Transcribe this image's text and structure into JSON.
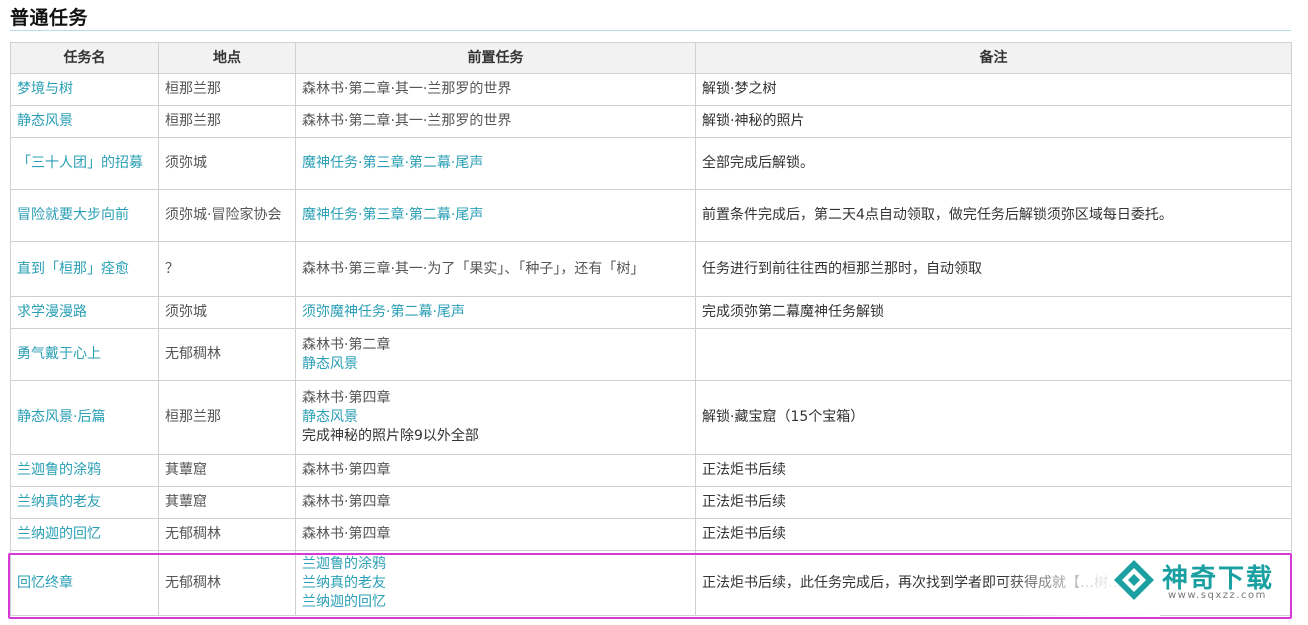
{
  "section_title": "普通任务",
  "table": {
    "headers": [
      "任务名",
      "地点",
      "前置任务",
      "备注"
    ],
    "rows": [
      {
        "name": "梦境与树",
        "location": "桓那兰那",
        "prereq": [
          "森林书·第二章·其一·兰那罗的世界"
        ],
        "prereq_link": false,
        "note": "解锁·梦之树"
      },
      {
        "name": "静态风景",
        "location": "桓那兰那",
        "prereq": [
          "森林书·第二章·其一·兰那罗的世界"
        ],
        "prereq_link": false,
        "note": "解锁·神秘的照片"
      },
      {
        "name": "「三十人团」的招募",
        "location": "须弥城",
        "prereq": [
          "魔神任务·第三章·第二幕·尾声"
        ],
        "prereq_link": true,
        "note": "全部完成后解锁。"
      },
      {
        "name": "冒险就要大步向前",
        "location": "须弥城·冒险家协会",
        "prereq": [
          "魔神任务·第三章·第二幕·尾声"
        ],
        "prereq_link": true,
        "note": "前置条件完成后，第二天4点自动领取，做完任务后解锁须弥区域每日委托。"
      },
      {
        "name": "直到「桓那」痊愈",
        "location": "？",
        "prereq": [
          "森林书·第三章·其一·为了「果实」、「种子」，还有「树」"
        ],
        "prereq_link": false,
        "note": "任务进行到前往往西的桓那兰那时，自动领取"
      },
      {
        "name": "求学漫漫路",
        "location": "须弥城",
        "prereq": [
          "须弥魔神任务·第二幕·尾声"
        ],
        "prereq_link": true,
        "note": "完成须弥第二幕魔神任务解锁"
      },
      {
        "name": "勇气戴于心上",
        "location": "无郁稠林",
        "prereq": [
          "森林书·第二章",
          "静态风景"
        ],
        "prereq_link_lines": [
          false,
          true
        ],
        "note": ""
      },
      {
        "name": "静态风景·后篇",
        "location": "桓那兰那",
        "prereq": [
          "森林书·第四章",
          "静态风景",
          "完成神秘的照片除9以外全部"
        ],
        "prereq_link_lines": [
          false,
          true,
          false
        ],
        "note": "解锁·藏宝窟（15个宝箱）"
      },
      {
        "name": "兰迦鲁的涂鸦",
        "location": "萁蕈窟",
        "prereq": [
          "森林书·第四章"
        ],
        "prereq_link": false,
        "note": "正法炬书后续"
      },
      {
        "name": "兰纳真的老友",
        "location": "萁蕈窟",
        "prereq": [
          "森林书·第四章"
        ],
        "prereq_link": false,
        "note": "正法炬书后续"
      },
      {
        "name": "兰纳迦的回忆",
        "location": "无郁稠林",
        "prereq": [
          "森林书·第四章"
        ],
        "prereq_link": false,
        "note": "正法炬书后续"
      },
      {
        "name": "回忆终章",
        "location": "无郁稠林",
        "prereq": [
          "兰迦鲁的涂鸦",
          "兰纳真的老友",
          "兰纳迦的回忆"
        ],
        "prereq_link_lines": [
          true,
          true,
          true
        ],
        "note": "正法炬书后续，此任务完成后，再次找到学者即可获得成就【…树…】"
      }
    ]
  },
  "watermark": {
    "brand": "神奇下载",
    "url": "www.sqxzz.com"
  },
  "colors": {
    "link": "#2a9fb5",
    "highlight": "#d63ad6",
    "header_bg": "#f2f2f2"
  }
}
